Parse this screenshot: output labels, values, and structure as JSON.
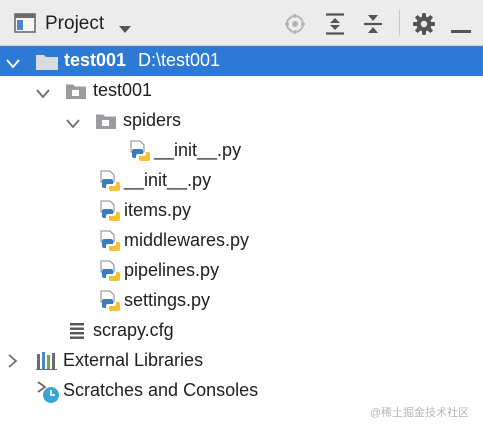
{
  "header": {
    "title": "Project"
  },
  "tree": {
    "root": {
      "label": "test001",
      "path": "D:\\test001"
    },
    "package": {
      "label": "test001"
    },
    "spiders_folder": {
      "label": "spiders"
    },
    "spiders_init": {
      "label": "__init__.py"
    },
    "pkg_init": {
      "label": "__init__.py"
    },
    "items": {
      "label": "items.py"
    },
    "middlewares": {
      "label": "middlewares.py"
    },
    "pipelines": {
      "label": "pipelines.py"
    },
    "settings": {
      "label": "settings.py"
    },
    "scrapy_cfg": {
      "label": "scrapy.cfg"
    },
    "external_libraries": {
      "label": "External Libraries"
    },
    "scratches": {
      "label": "Scratches and Consoles"
    }
  },
  "watermark": "@稀土掘金技术社区",
  "colors": {
    "selection": "#2c7ad6",
    "header_bg": "#ececec",
    "folder_gray": "#9a9ca0",
    "python_blue": "#3f7cbf",
    "python_yellow": "#f2c230"
  },
  "icons": {
    "panel": "project-panel-icon",
    "dropdown": "chevron-down-icon",
    "locate": "crosshair-icon",
    "expand_all": "expand-all-icon",
    "collapse_all": "collapse-all-icon",
    "settings": "gear-icon",
    "hide": "minimize-icon"
  }
}
